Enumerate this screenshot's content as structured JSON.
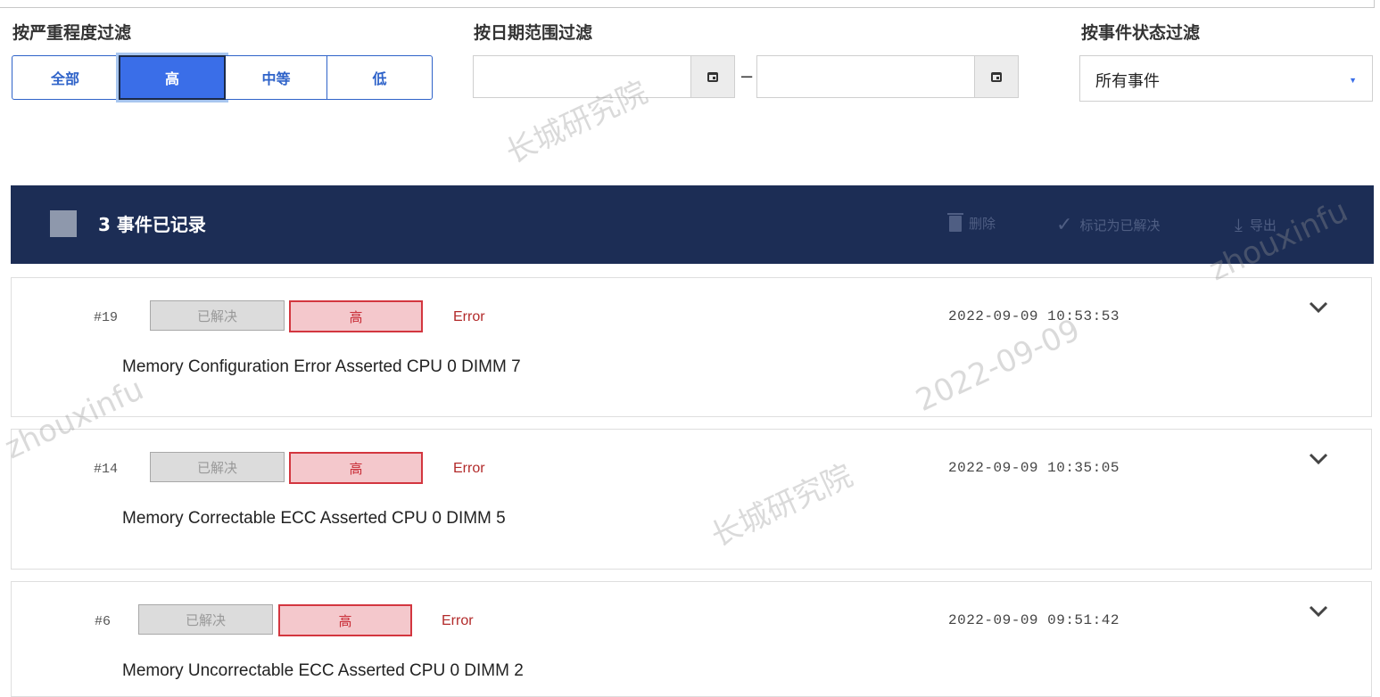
{
  "filters": {
    "severity_label": "按严重程度过滤",
    "severity_options": [
      "全部",
      "高",
      "中等",
      "低"
    ],
    "severity_selected": "高",
    "date_label": "按日期范围过滤",
    "date_from": "",
    "date_to": "",
    "date_separator": "–",
    "status_label": "按事件状态过滤",
    "status_selected": "所有事件"
  },
  "toolbar": {
    "count_text": "3 事件已记录",
    "delete_label": "删除",
    "resolve_label": "标记为已解决",
    "export_label": "导出"
  },
  "events": [
    {
      "id": "#19",
      "status": "已解决",
      "severity": "高",
      "type": "Error",
      "time": "2022-09-09 10:53:53",
      "description": "Memory Configuration Error Asserted CPU 0 DIMM 7"
    },
    {
      "id": "#14",
      "status": "已解决",
      "severity": "高",
      "type": "Error",
      "time": "2022-09-09 10:35:05",
      "description": "Memory Correctable ECC Asserted CPU 0 DIMM 5"
    },
    {
      "id": "#6",
      "status": "已解决",
      "severity": "高",
      "type": "Error",
      "time": "2022-09-09 09:51:42",
      "description": "Memory Uncorrectable ECC Asserted CPU 0 DIMM 2"
    }
  ],
  "watermarks": [
    "长城研究院",
    "2022-09-09",
    "zhouxinfu"
  ],
  "colors": {
    "accent": "#3a6ee8",
    "toolbar_bg": "#1c2d55",
    "severity_high": "#d3363f",
    "error_text": "#b22a2a"
  },
  "icons": {
    "calendar": "calendar-icon",
    "select_caret": "caret-down-icon",
    "delete": "trash-icon",
    "resolve": "check-icon",
    "export": "download-icon",
    "expand": "chevron-down-icon"
  }
}
